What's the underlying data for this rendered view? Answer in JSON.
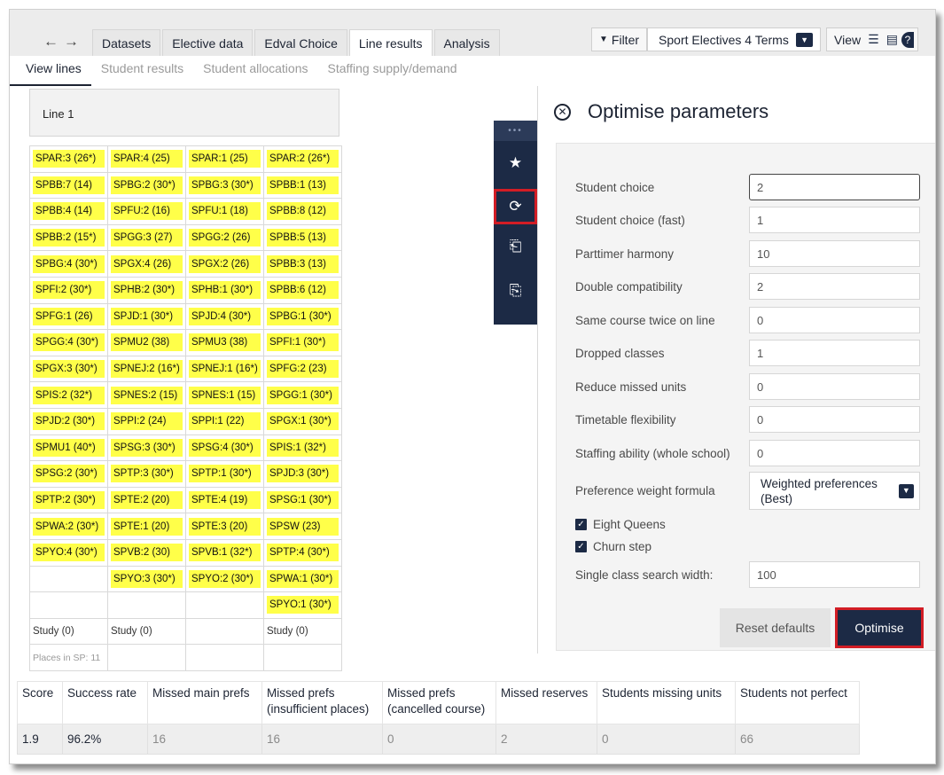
{
  "topbar": {
    "tabs": [
      {
        "label": "Datasets",
        "active": false
      },
      {
        "label": "Elective data",
        "active": false
      },
      {
        "label": "Edval Choice",
        "active": false
      },
      {
        "label": "Line results",
        "active": true
      },
      {
        "label": "Analysis",
        "active": false
      }
    ],
    "filter_label": "Filter",
    "term_select": "Sport Electives 4 Terms",
    "view_label": "View"
  },
  "subtabs": [
    {
      "label": "View lines",
      "active": true
    },
    {
      "label": "Student results",
      "active": false
    },
    {
      "label": "Student allocations",
      "active": false
    },
    {
      "label": "Staffing supply/demand",
      "active": false
    }
  ],
  "line": {
    "title": "Line 1",
    "rows": [
      [
        "SPAR:3 (26*)",
        "SPAR:4 (25)",
        "SPAR:1 (25)",
        "SPAR:2 (26*)"
      ],
      [
        "SPBB:7 (14)",
        "SPBG:2 (30*)",
        "SPBG:3 (30*)",
        "SPBB:1 (13)"
      ],
      [
        "SPBB:4 (14)",
        "SPFU:2 (16)",
        "SPFU:1 (18)",
        "SPBB:8 (12)"
      ],
      [
        "SPBB:2 (15*)",
        "SPGG:3 (27)",
        "SPGG:2 (26)",
        "SPBB:5 (13)"
      ],
      [
        "SPBG:4 (30*)",
        "SPGX:4 (26)",
        "SPGX:2 (26)",
        "SPBB:3 (13)"
      ],
      [
        "SPFI:2 (30*)",
        "SPHB:2 (30*)",
        "SPHB:1 (30*)",
        "SPBB:6 (12)"
      ],
      [
        "SPFG:1 (26)",
        "SPJD:1 (30*)",
        "SPJD:4 (30*)",
        "SPBG:1 (30*)"
      ],
      [
        "SPGG:4 (30*)",
        "SPMU2 (38)",
        "SPMU3 (38)",
        "SPFI:1 (30*)"
      ],
      [
        "SPGX:3 (30*)",
        "SPNEJ:2 (16*)",
        "SPNEJ:1 (16*)",
        "SPFG:2 (23)"
      ],
      [
        "SPIS:2 (32*)",
        "SPNES:2 (15)",
        "SPNES:1 (15)",
        "SPGG:1 (30*)"
      ],
      [
        "SPJD:2 (30*)",
        "SPPI:2 (24)",
        "SPPI:1 (22)",
        "SPGX:1 (30*)"
      ],
      [
        "SPMU1 (40*)",
        "SPSG:3 (30*)",
        "SPSG:4 (30*)",
        "SPIS:1 (32*)"
      ],
      [
        "SPSG:2 (30*)",
        "SPTP:3 (30*)",
        "SPTP:1 (30*)",
        "SPJD:3 (30*)"
      ],
      [
        "SPTP:2 (30*)",
        "SPTE:2 (20)",
        "SPTE:4 (19)",
        "SPSG:1 (30*)"
      ],
      [
        "SPWA:2 (30*)",
        "SPTE:1 (20)",
        "SPTE:3 (20)",
        "SPSW (23)"
      ],
      [
        "SPYO:4 (30*)",
        "SPVB:2 (30)",
        "SPVB:1 (32*)",
        "SPTP:4 (30*)"
      ],
      [
        "",
        "SPYO:3 (30*)",
        "SPYO:2 (30*)",
        "SPWA:1 (30*)"
      ],
      [
        "",
        "",
        "",
        "SPYO:1 (30*)"
      ]
    ],
    "study": [
      "Study (0)",
      "Study (0)",
      "",
      "Study (0)"
    ],
    "places": "Places in SP: 11"
  },
  "optimise": {
    "title": "Optimise parameters",
    "params": [
      {
        "label": "Student choice",
        "value": "2"
      },
      {
        "label": "Student choice (fast)",
        "value": "1"
      },
      {
        "label": "Parttimer harmony",
        "value": "10"
      },
      {
        "label": "Double compatibility",
        "value": "2"
      },
      {
        "label": "Same course twice on line",
        "value": "0"
      },
      {
        "label": "Dropped classes",
        "value": "1"
      },
      {
        "label": "Reduce missed units",
        "value": "0"
      },
      {
        "label": "Timetable flexibility",
        "value": "0"
      },
      {
        "label": "Staffing ability (whole school)",
        "value": "0"
      }
    ],
    "formula_label": "Preference weight formula",
    "formula_value": "Weighted preferences (Best)",
    "checks": [
      {
        "label": "Eight Queens",
        "checked": true
      },
      {
        "label": "Churn step",
        "checked": true
      }
    ],
    "search_width_label": "Single class search width:",
    "search_width_value": "100",
    "reset_label": "Reset defaults",
    "optimise_label": "Optimise"
  },
  "stats": {
    "headers": [
      "Score",
      "Success rate",
      "Missed main prefs",
      "Missed prefs (insufficient places)",
      "Missed prefs (cancelled course)",
      "Missed reserves",
      "Students missing units",
      "Students not perfect"
    ],
    "values": [
      "1.9",
      "96.2%",
      "16",
      "16",
      "0",
      "2",
      "0",
      "66"
    ]
  }
}
